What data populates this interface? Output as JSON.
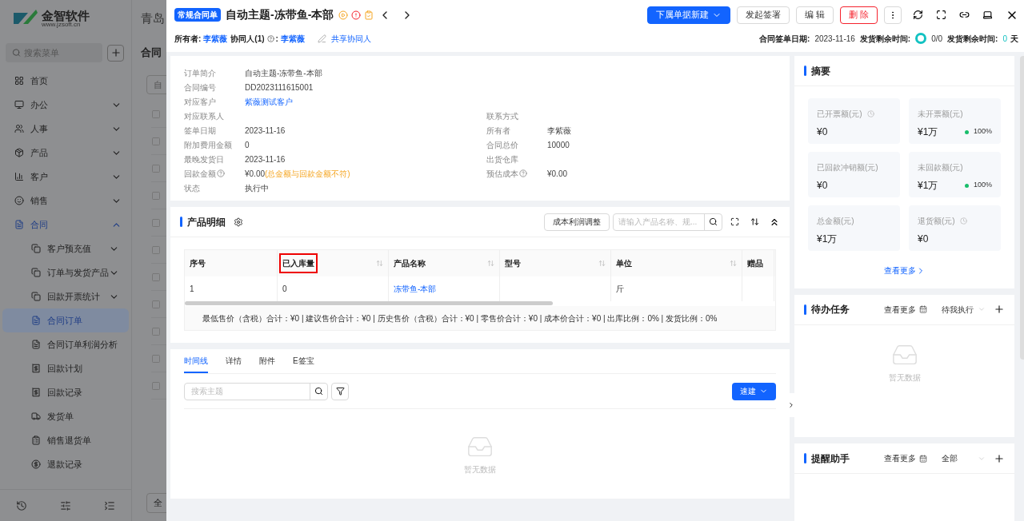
{
  "background": {
    "brand": {
      "name": "金智软件",
      "url": "www.jzsoft.cn"
    },
    "search": {
      "placeholder": "搜索菜单"
    },
    "menu": [
      {
        "label": "首页",
        "selected": false
      },
      {
        "label": "办公",
        "selected": false,
        "expanded": false
      },
      {
        "label": "人事",
        "selected": false,
        "expanded": false
      },
      {
        "label": "产品",
        "selected": false,
        "expanded": false
      },
      {
        "label": "客户",
        "selected": false,
        "expanded": false
      },
      {
        "label": "销售",
        "selected": false,
        "expanded": false
      },
      {
        "label": "合同",
        "selected": true,
        "expanded": true,
        "children": [
          {
            "label": "客户预充值",
            "selected": false,
            "expanded": false
          },
          {
            "label": "订单与发货产品",
            "selected": false,
            "expanded": false
          },
          {
            "label": "回款开票统计",
            "selected": false,
            "expanded": false
          },
          {
            "label": "合同订单",
            "selected": true
          },
          {
            "label": "合同订单利润分析",
            "selected": false
          },
          {
            "label": "回款计划",
            "selected": false
          },
          {
            "label": "回款记录",
            "selected": false
          },
          {
            "label": "发货单",
            "selected": false
          },
          {
            "label": "销售退货单",
            "selected": false
          },
          {
            "label": "退款记录",
            "selected": false
          }
        ]
      }
    ],
    "page_title": "青岛",
    "tab_title": "合同",
    "filter_value": "自",
    "footer_button": "全"
  },
  "drawer": {
    "badge": "常规合同单",
    "title": "自动主题-冻带鱼-本部",
    "actions": [
      {
        "label": "下属单据新建",
        "kind": "primary"
      },
      {
        "label": "发起签署",
        "kind": "default"
      },
      {
        "label": "编 辑",
        "kind": "default"
      },
      {
        "label": "删 除",
        "kind": "danger"
      }
    ],
    "owner": {
      "label": "所有者:",
      "value": "李紫薇"
    },
    "collaborator": {
      "label": "协同人(1)",
      "separator": ":",
      "value": "李紫薇"
    },
    "share_link": "共享协同人",
    "meta": [
      {
        "label": "合同签单日期:",
        "value": "2023-11-16"
      },
      {
        "label": "发货剩余时间:",
        "value": "0/0",
        "kind": "ring"
      },
      {
        "label": "发货剩余时间:",
        "value": "0",
        "unit": "天",
        "kind": "days"
      }
    ],
    "info": [
      {
        "left": {
          "label": "订单简介",
          "value": "自动主题-冻带鱼-本部"
        }
      },
      {
        "left": {
          "label": "合同编号",
          "value": "DD2023111615001"
        }
      },
      {
        "left": {
          "label": "对应客户",
          "value": "紫薇测试客户",
          "kind": "link"
        }
      },
      {
        "left": {
          "label": "对应联系人"
        },
        "right": {
          "label": "联系方式"
        }
      },
      {
        "left": {
          "label": "签单日期",
          "value": "2023-11-16"
        },
        "right": {
          "label": "所有者",
          "value": "李紫薇"
        }
      },
      {
        "left": {
          "label": "附加费用金额",
          "value": "0"
        },
        "right": {
          "label": "合同总价",
          "value": "10000"
        }
      },
      {
        "left": {
          "label": "最晚发货日",
          "value": "2023-11-16"
        },
        "right": {
          "label": "出货仓库"
        }
      },
      {
        "left": {
          "label": "回款金额",
          "help": true,
          "value": "¥0.00",
          "note": "(总金额与回款金额不符)"
        },
        "right": {
          "label": "预估成本",
          "help": true,
          "value": "¥0.00"
        }
      },
      {
        "left": {
          "label": "状态",
          "value": "执行中"
        }
      }
    ],
    "products": {
      "title": "产品明细",
      "adjust_button": "成本利润调整",
      "search": {
        "placeholder": "请输入产品名称、规..."
      },
      "columns": [
        {
          "label": "序号",
          "sortable": false,
          "highlighted": false
        },
        {
          "label": "已入库量",
          "sortable": true,
          "highlighted": true
        },
        {
          "label": "产品名称",
          "sortable": true,
          "highlighted": false
        },
        {
          "label": "型号",
          "sortable": true,
          "highlighted": false
        },
        {
          "label": "单位",
          "sortable": true,
          "highlighted": false
        },
        {
          "label": "赠品",
          "sortable": false,
          "highlighted": false
        }
      ],
      "rows": [
        {
          "no": "1",
          "stock_in": "0",
          "product": {
            "text": "冻带鱼-本部",
            "kind": "link"
          },
          "unit": "斤"
        }
      ],
      "summary": "最低售价（含税）合计：¥0 | 建议售价合计：¥0 | 历史售价（含税）合计：¥0 | 零售价合计：¥0 | 成本价合计：¥0 | 出库比例：0% | 发货比例：0%"
    },
    "tabs": [
      {
        "label": "时间线",
        "selected": true
      },
      {
        "label": "详情",
        "selected": false
      },
      {
        "label": "附件",
        "selected": false
      },
      {
        "label": "E签宝",
        "selected": false
      }
    ],
    "timeline": {
      "search": {
        "placeholder": "搜索主题"
      },
      "quick_button": "速建",
      "empty": "暂无数据"
    },
    "summary_panel": {
      "title": "摘要",
      "stats": [
        {
          "label": "已开票额(元)",
          "value": "¥0",
          "clock": true
        },
        {
          "label": "未开票额(元)",
          "value": "¥1万",
          "clock": false,
          "percent": "100%",
          "color": "#19be6b"
        },
        {
          "label": "已回款冲销额(元)",
          "value": "¥0",
          "clock": false
        },
        {
          "label": "未回款额(元)",
          "value": "¥1万",
          "clock": false,
          "percent": "100%",
          "color": "#19be6b"
        },
        {
          "label": "总金额(元)",
          "value": "¥1万",
          "clock": false
        },
        {
          "label": "退货额(元)",
          "value": "¥0",
          "clock": true
        }
      ],
      "more": "查看更多"
    },
    "tasks": {
      "title": "待办任务",
      "more": "查看更多",
      "filter": "待我执行",
      "empty": "暂无数据"
    },
    "reminders": {
      "title": "提醒助手",
      "more": "查看更多",
      "filter": "全部"
    }
  }
}
